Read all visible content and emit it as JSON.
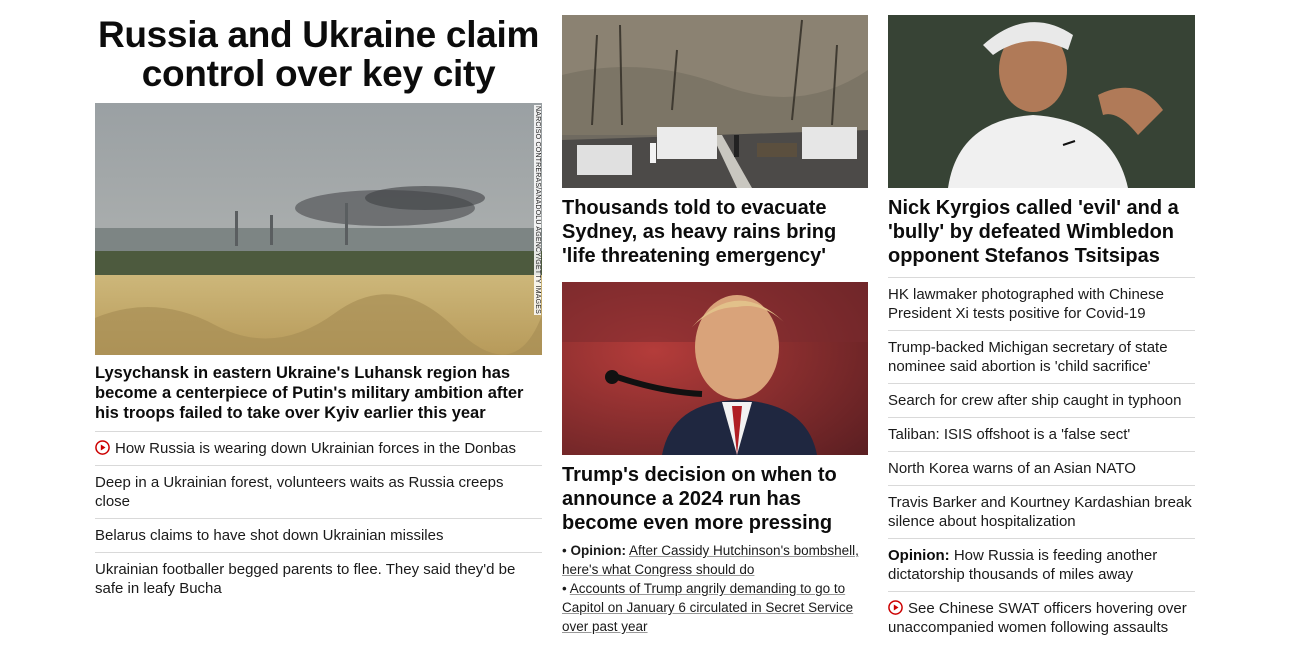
{
  "col1": {
    "title": "Russia and Ukraine claim control over key city",
    "image_credit": "NARCISO CONTRERAS/ANADOLU AGENCY/GETTY IMAGES",
    "lead": "Lysychansk in eastern Ukraine's Luhansk region has become a centerpiece of Putin's military ambition after his troops failed to take over Kyiv earlier this year",
    "links": [
      {
        "text": "How Russia is wearing down Ukrainian forces in the Donbas",
        "video": true
      },
      {
        "text": "Deep in a Ukrainian forest, volunteers waits as Russia creeps close"
      },
      {
        "text": "Belarus claims to have shot down Ukrainian missiles"
      },
      {
        "text": "Ukrainian footballer begged parents to flee. They said they'd be safe in leafy Bucha"
      }
    ]
  },
  "col2": {
    "story1": {
      "headline": "Thousands told to evacuate Sydney, as heavy rains bring 'life threatening emergency'"
    },
    "story2": {
      "headline": "Trump's decision on when to announce a 2024 run has become even more pressing",
      "bullets": [
        {
          "prefix": "Opinion:",
          "text": "After Cassidy Hutchinson's bombshell, here's what Congress should do"
        },
        {
          "prefix": "",
          "text": "Accounts of Trump angrily demanding to go to Capitol on January 6 circulated in Secret Service over past year"
        }
      ],
      "bullet_mark": "•"
    }
  },
  "col3": {
    "headline": "Nick Kyrgios called 'evil' and a 'bully' by defeated Wimbledon opponent Stefanos Tsitsipas",
    "links": [
      {
        "text": "HK lawmaker photographed with Chinese President Xi tests positive for Covid-19"
      },
      {
        "text": "Trump-backed Michigan secretary of state nominee said abortion is 'child sacrifice'"
      },
      {
        "text": "Search for crew after ship caught in typhoon"
      },
      {
        "text": "Taliban: ISIS offshoot is a 'false sect'"
      },
      {
        "text": "North Korea warns of an Asian NATO"
      },
      {
        "text": "Travis Barker and Kourtney Kardashian break silence about hospitalization"
      },
      {
        "prefix": "Opinion:",
        "text": "How Russia is feeding another dictatorship thousands of miles away"
      },
      {
        "text": "See Chinese SWAT officers hovering over unaccompanied women following assaults",
        "video": true
      }
    ]
  },
  "colors": {
    "video_red": "#cc0000",
    "divider": "#d9d9d9",
    "text": "#0c0c0c"
  }
}
